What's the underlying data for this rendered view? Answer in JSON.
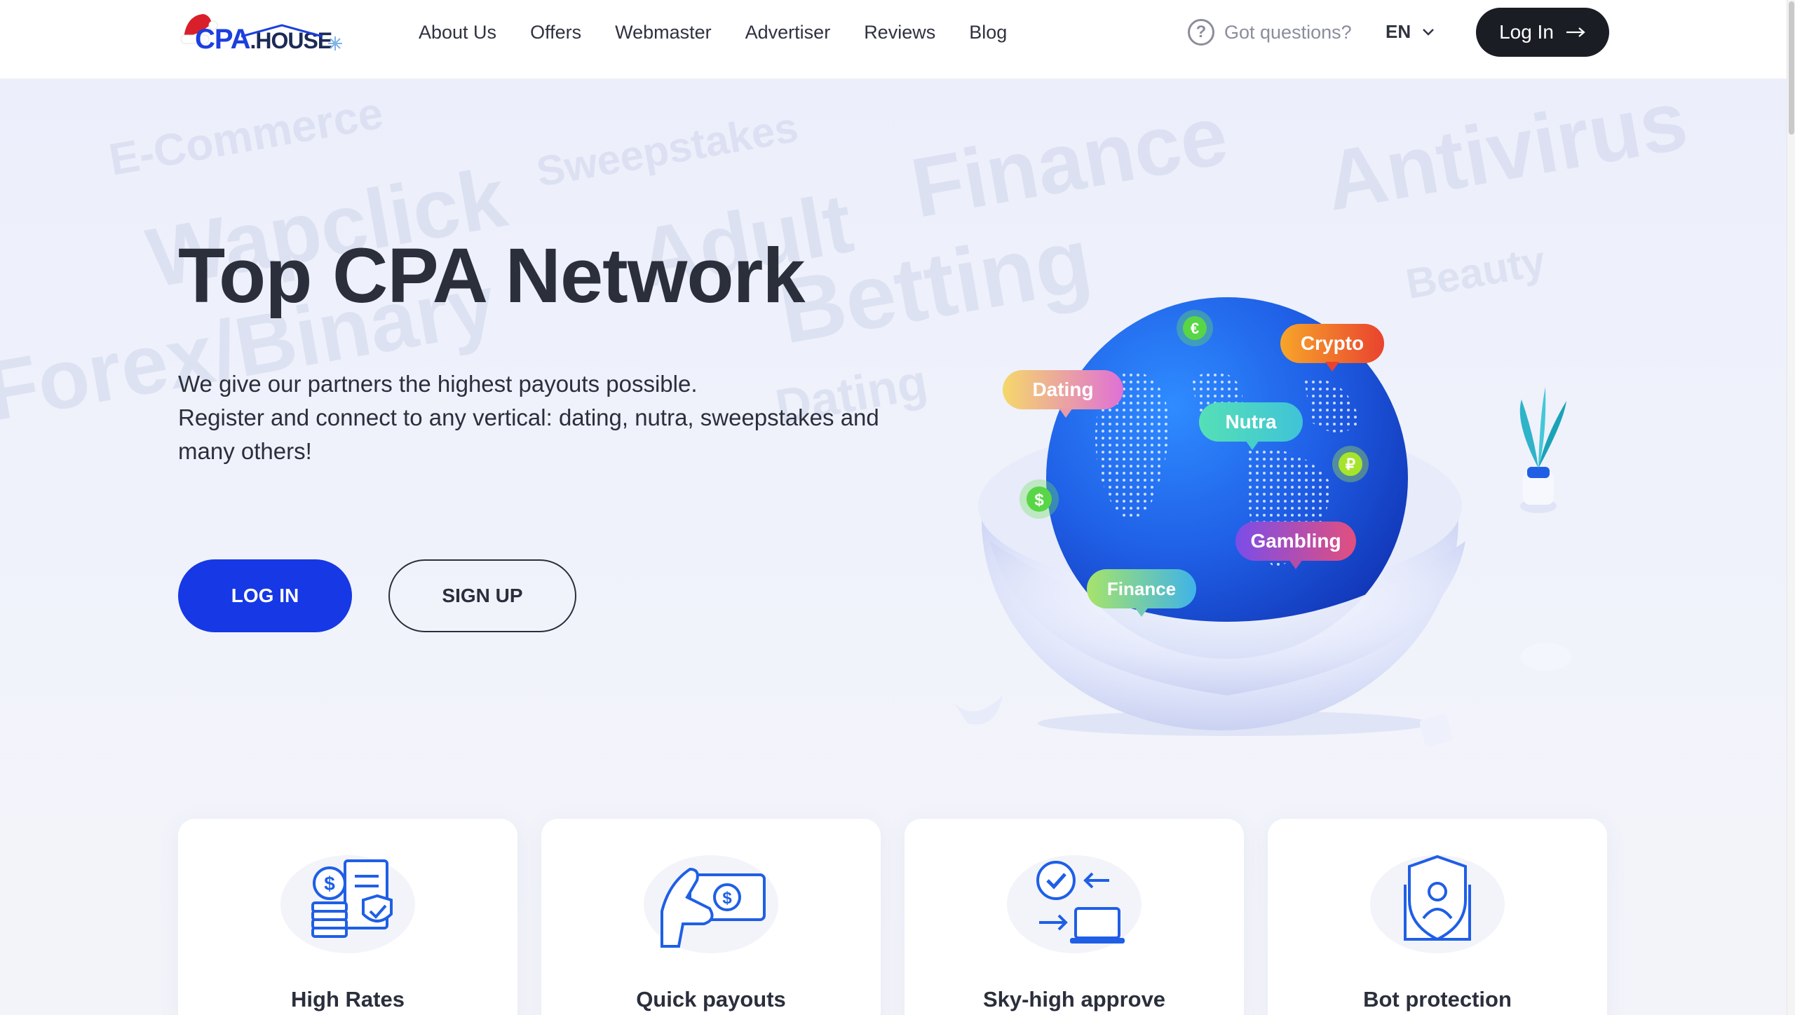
{
  "header": {
    "logo": {
      "part1": "CPA",
      "part2": ".HOUSE"
    },
    "nav": [
      "About Us",
      "Offers",
      "Webmaster",
      "Advertiser",
      "Reviews",
      "Blog"
    ],
    "questions_label": "Got questions?",
    "lang": "EN",
    "login_label": "Log In"
  },
  "hero": {
    "title": "Top CPA Network",
    "subtitle_lines": [
      "We give our partners the highest payouts possible.",
      "Register and connect to any vertical: dating, nutra, sweepstakes and",
      "many others!"
    ],
    "login_button": "LOG IN",
    "signup_button": "SIGN UP",
    "background_words": [
      "E-Commerce",
      "Wapclick",
      "Sweepstakes",
      "Adult",
      "Finance",
      "Antivirus",
      "Betting",
      "Dating",
      "Forex/Binary",
      "Beauty"
    ],
    "bubbles": [
      "Crypto",
      "Dating",
      "Nutra",
      "Gambling",
      "Finance"
    ],
    "coins": [
      "€",
      "$",
      "₽"
    ]
  },
  "features": [
    {
      "title": "High Rates",
      "icon": "coins-document-icon"
    },
    {
      "title": "Quick payouts",
      "icon": "hand-money-icon"
    },
    {
      "title": "Sky-high approve",
      "icon": "approve-laptop-icon"
    },
    {
      "title": "Bot protection",
      "icon": "shield-user-icon"
    }
  ],
  "colors": {
    "accent": "#1638e5",
    "dark_button": "#1a1d24",
    "text": "#2b2f3c",
    "muted": "#8a8e9c"
  }
}
